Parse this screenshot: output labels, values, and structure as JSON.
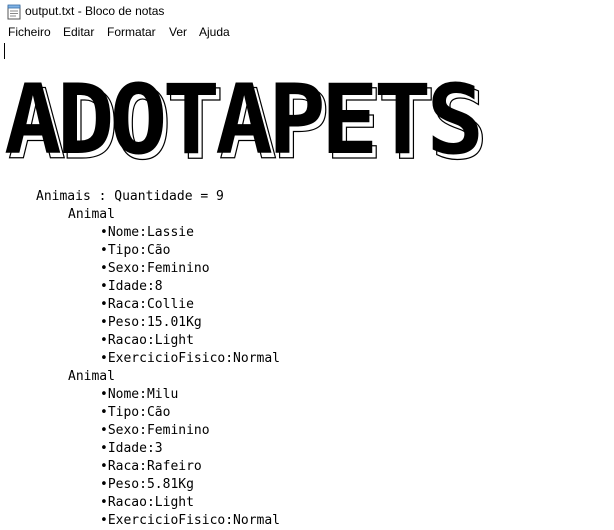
{
  "window": {
    "title": "output.txt - Bloco de notas",
    "app_icon": "notepad-icon"
  },
  "menu": [
    "Ficheiro",
    "Editar",
    "Formatar",
    "Ver",
    "Ajuda"
  ],
  "banner": {
    "text": "ADOTAPETS",
    "fill_color": "#000000",
    "outline_color": "#000000"
  },
  "content": {
    "header": "Animais : Quantidade = 9",
    "animals": [
      {
        "label": "Animal",
        "fields": [
          "•Nome:Lassie",
          "•Tipo:Cão",
          "•Sexo:Feminino",
          "•Idade:8",
          "•Raca:Collie",
          "•Peso:15.01Kg",
          "•Racao:Light",
          "•ExercicioFisico:Normal"
        ]
      },
      {
        "label": "Animal",
        "fields": [
          "•Nome:Milu",
          "•Tipo:Cão",
          "•Sexo:Feminino",
          "•Idade:3",
          "•Raca:Rafeiro",
          "•Peso:5.81Kg",
          "•Racao:Light",
          "•ExercicioFisico:Normal"
        ]
      }
    ]
  }
}
